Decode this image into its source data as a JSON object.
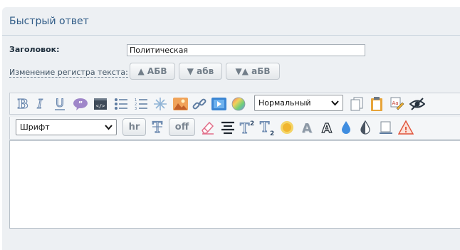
{
  "quick_reply": {
    "title": "Быстрый ответ",
    "subject_label": "Заголовок:",
    "subject_value": "Политическая",
    "case_label": "Изменение регистра текста:",
    "case_buttons": [
      "▲ АБВ",
      "▼ абв",
      "▼▲ аБВ"
    ]
  },
  "editor": {
    "toolbar1": {
      "icons": [
        "bold-icon",
        "italic-icon",
        "underline-icon",
        "quote-icon",
        "code-icon",
        "unordered-list-icon",
        "ordered-list-icon",
        "spoiler-icon",
        "image-icon",
        "link-icon",
        "video-icon",
        "color-icon",
        "copy-icon",
        "paste-icon",
        "spellcheck-icon",
        "hide-icon"
      ],
      "format_select": "Нормальный"
    },
    "toolbar2": {
      "icons": [
        "font-size-icon",
        "eraser-icon",
        "align-icon",
        "superscript-icon",
        "subscript-icon",
        "sun-icon",
        "shadow-text-icon",
        "outline-text-icon",
        "drop-icon",
        "contrast-icon",
        "background-icon",
        "warning-icon"
      ],
      "font_select": "Шрифт",
      "hr_label": "hr",
      "off_label": "off"
    },
    "text": ""
  },
  "colors": {
    "panel_bg": "#edf0f3",
    "title": "#2f5b86",
    "icon_blue": "#5b7aa0"
  }
}
